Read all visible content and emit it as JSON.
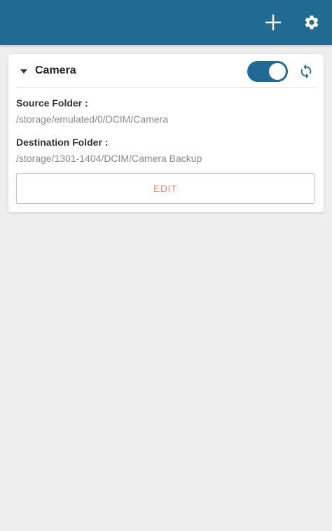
{
  "appbar": {
    "add_icon": "plus-icon",
    "settings_icon": "gear-icon",
    "color": "#216b93"
  },
  "card": {
    "title": "Camera",
    "collapse_icon": "caret-down-icon",
    "sync_toggle": "on",
    "sync_icon": "sync-icon",
    "source_label": "Source Folder :",
    "source_path": "/storage/emulated/0/DCIM/Camera",
    "destination_label": "Destination Folder :",
    "destination_path": "/storage/1301-1404/DCIM/Camera Backup",
    "edit_label": "EDIT"
  },
  "colors": {
    "accent": "#216b93",
    "edit_text": "#ee8a73",
    "background": "#eeeeee"
  }
}
